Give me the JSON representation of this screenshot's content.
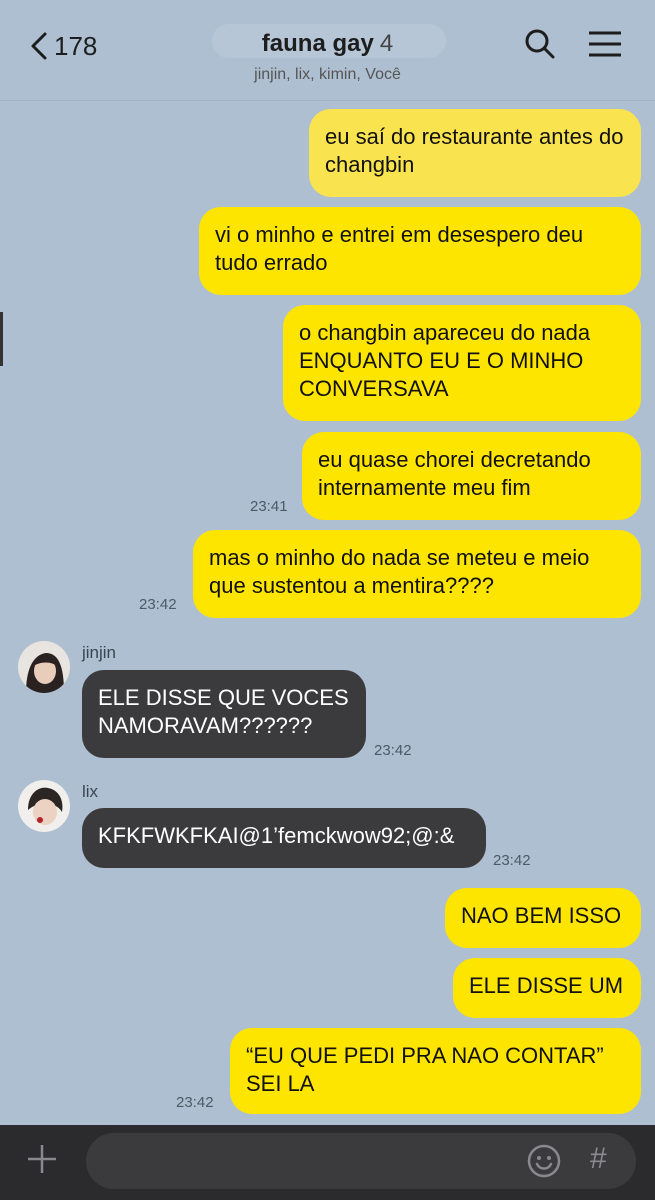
{
  "header": {
    "back_count": "178",
    "title": "fauna gay",
    "member_count": "4",
    "members": "jinjin, lix, kimin, Você"
  },
  "messages": [
    {
      "from": "me",
      "text": "eu saí do restaurante antes do changbin"
    },
    {
      "from": "me",
      "text": "vi o minho e entrei em desespero deu tudo errado"
    },
    {
      "from": "me",
      "text": "o changbin apareceu do nada ENQUANTO EU E O MINHO CONVERSAVA"
    },
    {
      "from": "me",
      "text": "eu quase chorei decretando internamente meu fim",
      "time": "23:41"
    },
    {
      "from": "me",
      "text": "mas o minho do nada se meteu e meio que sustentou a mentira????",
      "time": "23:42"
    },
    {
      "from": "jinjin",
      "sender": "jinjin",
      "text": "ELE DISSE QUE VOCES NAMORAVAM??????",
      "time": "23:42"
    },
    {
      "from": "lix",
      "sender": "lix",
      "text": "KFKFWKFKAI@1’femckwow92;@:&",
      "time": "23:42"
    },
    {
      "from": "me",
      "text": "NAO BEM ISSO"
    },
    {
      "from": "me",
      "text": "ELE DISSE UM"
    },
    {
      "from": "me",
      "text": "“EU QUE PEDI PRA NAO CONTAR” SEI LA",
      "time": "23:42"
    }
  ],
  "icons": {
    "back": "chevron-left-icon",
    "search": "search-icon",
    "menu": "hamburger-menu-icon",
    "plus": "plus-icon",
    "emoji": "emoji-icon",
    "hash": "hash-icon"
  },
  "composer": {
    "value": "",
    "hash_symbol": "#"
  },
  "colors": {
    "background": "#aebfd2",
    "my_bubble": "#fee500",
    "their_bubble": "#3b3b3d",
    "bottom_bar": "#2b2b2d"
  }
}
